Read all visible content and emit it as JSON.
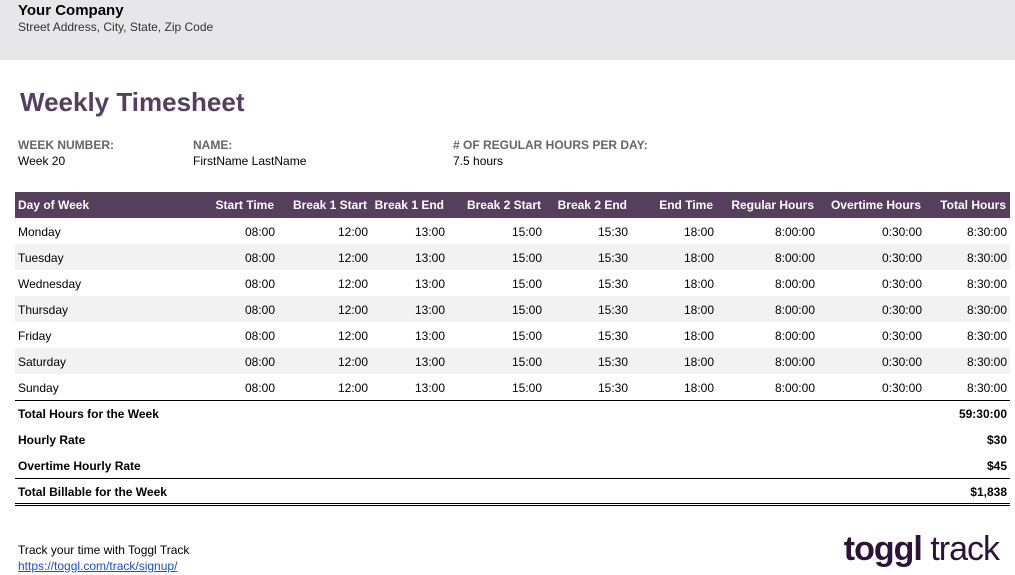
{
  "company": {
    "name": "Your Company",
    "address": "Street Address, City, State, Zip Code"
  },
  "title": "Weekly Timesheet",
  "meta": [
    {
      "label": "WEEK NUMBER:",
      "value": "Week 20"
    },
    {
      "label": "NAME:",
      "value": "FirstName LastName"
    },
    {
      "label": "# OF REGULAR HOURS PER DAY:",
      "value": "7.5 hours"
    }
  ],
  "table": {
    "headers": [
      "Day of Week",
      "Start Time",
      "Break 1 Start",
      "Break 1 End",
      "Break 2 Start",
      "Break 2 End",
      "End Time",
      "Regular Hours",
      "Overtime Hours",
      "Total Hours"
    ],
    "rows": [
      [
        "Monday",
        "08:00",
        "12:00",
        "13:00",
        "15:00",
        "15:30",
        "18:00",
        "8:00:00",
        "0:30:00",
        "8:30:00"
      ],
      [
        "Tuesday",
        "08:00",
        "12:00",
        "13:00",
        "15:00",
        "15:30",
        "18:00",
        "8:00:00",
        "0:30:00",
        "8:30:00"
      ],
      [
        "Wednesday",
        "08:00",
        "12:00",
        "13:00",
        "15:00",
        "15:30",
        "18:00",
        "8:00:00",
        "0:30:00",
        "8:30:00"
      ],
      [
        "Thursday",
        "08:00",
        "12:00",
        "13:00",
        "15:00",
        "15:30",
        "18:00",
        "8:00:00",
        "0:30:00",
        "8:30:00"
      ],
      [
        "Friday",
        "08:00",
        "12:00",
        "13:00",
        "15:00",
        "15:30",
        "18:00",
        "8:00:00",
        "0:30:00",
        "8:30:00"
      ],
      [
        "Saturday",
        "08:00",
        "12:00",
        "13:00",
        "15:00",
        "15:30",
        "18:00",
        "8:00:00",
        "0:30:00",
        "8:30:00"
      ],
      [
        "Sunday",
        "08:00",
        "12:00",
        "13:00",
        "15:00",
        "15:30",
        "18:00",
        "8:00:00",
        "0:30:00",
        "8:30:00"
      ]
    ]
  },
  "summary": [
    {
      "label": "Total Hours for the Week",
      "value": "59:30:00"
    },
    {
      "label": "Hourly Rate",
      "value": "$30"
    },
    {
      "label": "Overtime Hourly Rate",
      "value": "$45"
    },
    {
      "label": "Total Billable for the Week",
      "value": "$1,838"
    }
  ],
  "footer": {
    "text": "Track your time with Toggl Track",
    "link": "https://toggl.com/track/signup/"
  },
  "logo": {
    "bold": "toggl",
    "light": "track"
  },
  "colors": {
    "accent": "#553f5c",
    "header_bg": "#e7e6e9",
    "alt_row": "#f2f2f2"
  }
}
